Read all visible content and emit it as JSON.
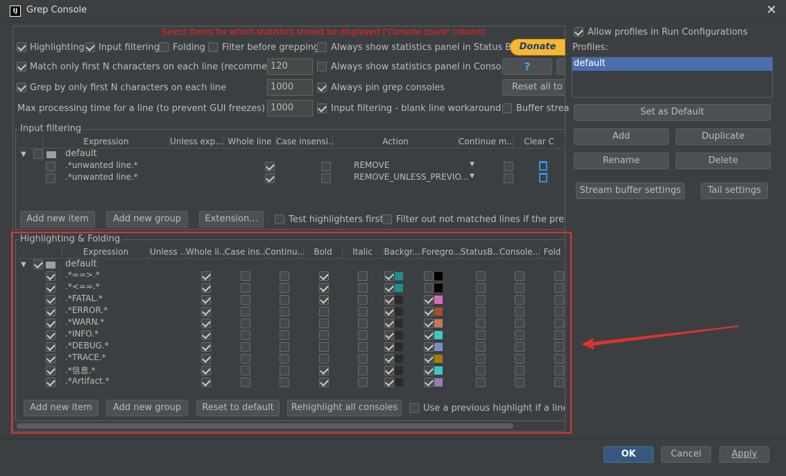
{
  "window": {
    "title": "Grep Console",
    "app_icon": "IJ"
  },
  "stats_notice": "Select items for which statistics should be displayed ('Console count' column)",
  "options": {
    "highlighting": {
      "label": "Highlighting",
      "checked": true
    },
    "input_filtering": {
      "label": "Input filtering",
      "checked": true
    },
    "folding": {
      "label": "Folding",
      "checked": false
    },
    "filter_before": {
      "label": "Filter before grepping",
      "checked": false
    },
    "always_status_bar": {
      "label": "Always show statistics panel in Status Bar",
      "checked": false
    },
    "match_first_n": {
      "label": "Match only first N characters on each line (recommended)",
      "checked": true,
      "value": "120"
    },
    "always_console": {
      "label": "Always show statistics panel in Console",
      "checked": false
    },
    "grep_first_n": {
      "label": "Grep by only first N characters on each line",
      "checked": true,
      "value": "1000"
    },
    "pin_consoles": {
      "label": "Always pin grep consoles",
      "checked": true
    },
    "max_processing": {
      "label": "Max processing time for a line (to prevent GUI freezes) [ms]",
      "value": "1000"
    },
    "blank_line": {
      "label": "Input filtering - blank line workaround",
      "checked": true
    },
    "buffer_streams": {
      "label": "Buffer strea",
      "checked": false
    }
  },
  "side_buttons": {
    "donate": "Donate",
    "help": "?",
    "reset_all": "Reset all to d"
  },
  "input_filtering": {
    "title": "Input filtering",
    "columns": [
      "",
      "Expression",
      "Unless exp...",
      "Whole line",
      "Case insensi...",
      "Action",
      "Continue m...",
      "Clear C"
    ],
    "group": "default",
    "rows": [
      {
        "expr": ".*unwanted line.*",
        "whole": true,
        "case": false,
        "action": "REMOVE",
        "cont": false
      },
      {
        "expr": ".*unwanted line.*",
        "whole": true,
        "case": false,
        "action": "REMOVE_UNLESS_PREVIO...",
        "cont": false
      }
    ],
    "buttons": {
      "add_item": "Add new item",
      "add_group": "Add new group",
      "extension": "Extension..."
    },
    "test_first": {
      "label": "Test highlighters first",
      "checked": false
    },
    "filter_out": {
      "label": "Filter out not matched lines if the previous",
      "checked": false
    }
  },
  "highlighting": {
    "title": "Highlighting & Folding",
    "columns": [
      "",
      "Expression",
      "Unless ...",
      "Whole li...",
      "Case ins...",
      "Continu...",
      "Bold",
      "Italic",
      "Backgr...",
      "Foregro...",
      "StatusB...",
      "Console...",
      "Fold"
    ],
    "group": "default",
    "rows": [
      {
        "expr": ".*==>.*",
        "whole": true,
        "bold": true,
        "bg": true,
        "bgc": "#1a8f8f",
        "fg": false,
        "fgc": "#000000"
      },
      {
        "expr": ".*<==.*",
        "whole": true,
        "bold": true,
        "bg": true,
        "bgc": "#1a8f8f",
        "fg": false,
        "fgc": "#000000"
      },
      {
        "expr": ".*FATAL.*",
        "whole": true,
        "bold": true,
        "bg": true,
        "bgc": "#2b2b2b",
        "fg": true,
        "fgc": "#d36fb7"
      },
      {
        "expr": ".*ERROR.*",
        "whole": true,
        "bold": false,
        "bg": true,
        "bgc": "#2b2b2b",
        "fg": true,
        "fgc": "#a0522d"
      },
      {
        "expr": ".*WARN.*",
        "whole": true,
        "bold": false,
        "bg": true,
        "bgc": "#2b2b2b",
        "fg": true,
        "fgc": "#c8785a"
      },
      {
        "expr": ".*INFO.*",
        "whole": true,
        "bold": false,
        "bg": true,
        "bgc": "#2b2b2b",
        "fg": true,
        "fgc": "#3ec8c0"
      },
      {
        "expr": ".*DEBUG.*",
        "whole": true,
        "bold": false,
        "bg": true,
        "bgc": "#2b2b2b",
        "fg": true,
        "fgc": "#7a8ac8"
      },
      {
        "expr": ".*TRACE.*",
        "whole": true,
        "bold": false,
        "bg": true,
        "bgc": "#2b2b2b",
        "fg": true,
        "fgc": "#a08000"
      },
      {
        "expr": ".*信息.*",
        "whole": true,
        "bold": true,
        "bg": true,
        "bgc": "#2b2b2b",
        "fg": true,
        "fgc": "#3ec8c0"
      },
      {
        "expr": ".*Artifact.*",
        "whole": true,
        "bold": true,
        "bg": true,
        "bgc": "#2b2b2b",
        "fg": true,
        "fgc": "#9a7ab8"
      }
    ],
    "buttons": {
      "add_item": "Add new item",
      "add_group": "Add new group",
      "reset": "Reset to default",
      "rehighlight": "Rehighlight all consoles"
    },
    "use_previous": {
      "label": "Use a previous highlight if a line is",
      "checked": false
    }
  },
  "profiles": {
    "allow": {
      "label": "Allow profiles in Run Configurations",
      "checked": true
    },
    "label": "Profiles:",
    "items": [
      "default"
    ],
    "set_default": "Set as Default",
    "add": "Add",
    "duplicate": "Duplicate",
    "rename": "Rename",
    "delete": "Delete",
    "stream_buffer": "Stream buffer settings",
    "tail": "Tail settings"
  },
  "footer": {
    "ok": "OK",
    "cancel": "Cancel",
    "apply": "Apply"
  },
  "colors": {
    "accent": "#365880",
    "selection": "#2f65ca",
    "annotation": "#e0332d",
    "notice": "#ff2020"
  }
}
